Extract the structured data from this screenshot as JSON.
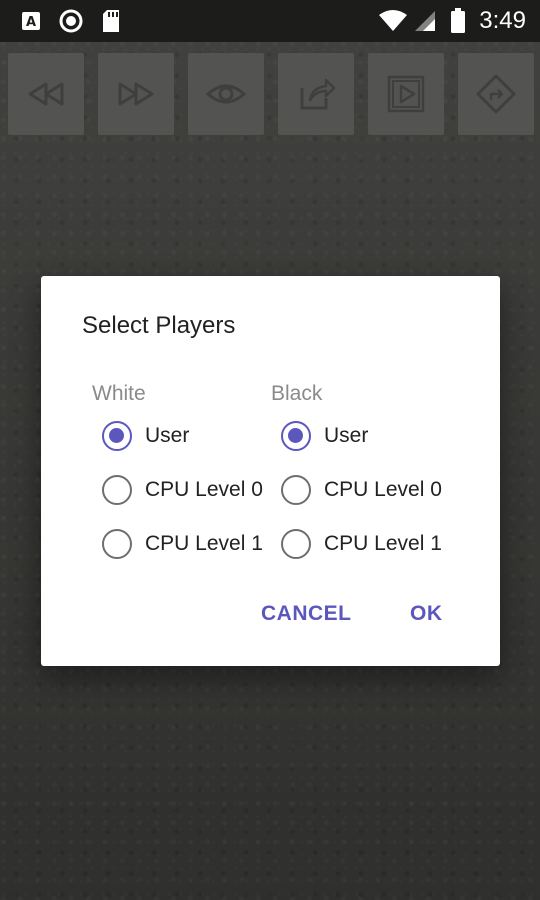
{
  "status_bar": {
    "time": "3:49",
    "icons": [
      "app-a-icon",
      "record-icon",
      "sd-card-icon",
      "wifi-icon",
      "cell-signal-icon",
      "battery-icon"
    ]
  },
  "toolbar": {
    "buttons": [
      "rewind-icon",
      "fast-forward-icon",
      "eye-icon",
      "share-icon",
      "play-icon",
      "navigation-icon"
    ]
  },
  "dialog": {
    "title": "Select Players",
    "white": {
      "label": "White",
      "options": [
        "User",
        "CPU Level 0",
        "CPU Level 1"
      ],
      "selected": "User"
    },
    "black": {
      "label": "Black",
      "options": [
        "User",
        "CPU Level 0",
        "CPU Level 1"
      ],
      "selected": "User"
    },
    "cancel_label": "CANCEL",
    "ok_label": "OK"
  },
  "colors": {
    "accent": "#5c57bd",
    "status_bar": "#1c1c1b",
    "toolbar_button": "#6f6f6c"
  }
}
